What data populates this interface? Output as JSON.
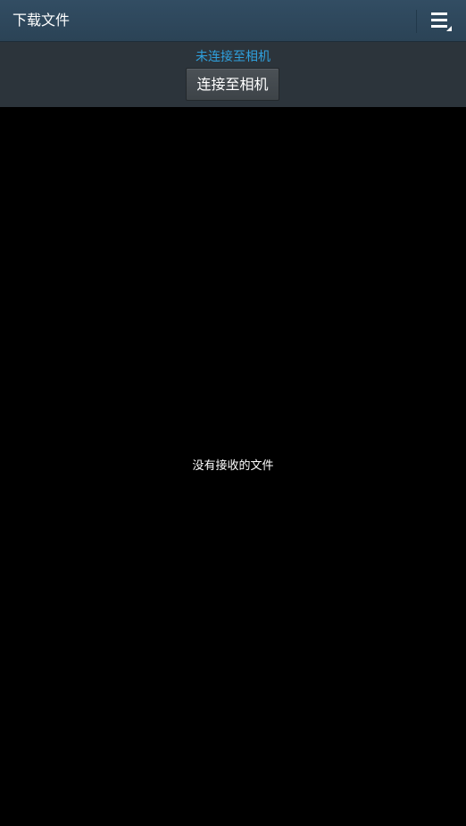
{
  "action_bar": {
    "title": "下载文件",
    "menu_icon": "overflow-menu-icon"
  },
  "status_panel": {
    "status_text": "未连接至相机",
    "connect_button_label": "连接至相机"
  },
  "content": {
    "empty_message": "没有接收的文件"
  },
  "colors": {
    "action_bar_bg": "#2f475b",
    "status_panel_bg": "#2c343b",
    "status_text": "#2fa0dd",
    "background": "#000000"
  }
}
